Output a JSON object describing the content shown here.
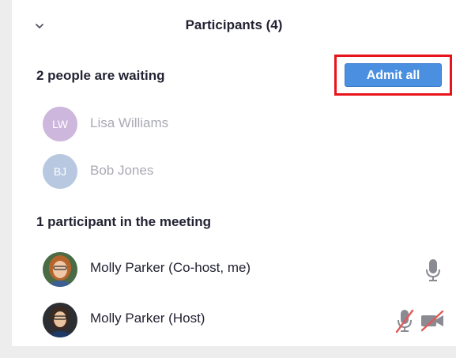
{
  "header": {
    "title": "Participants (4)",
    "collapse_icon": "chevron-down-icon"
  },
  "waiting_room": {
    "heading": "2 people are waiting",
    "admit_all_label": "Admit all",
    "highlight_color": "#e8141b",
    "people": [
      {
        "initials": "LW",
        "name": "Lisa Williams",
        "avatar_color": "#cdb7dc"
      },
      {
        "initials": "BJ",
        "name": "Bob Jones",
        "avatar_color": "#b7c8e0"
      }
    ]
  },
  "meeting": {
    "heading": "1 participant in the meeting",
    "participants": [
      {
        "name": "Molly Parker (Co-host, me)",
        "audio": "unmuted",
        "audio_icon": "microphone-icon"
      },
      {
        "name": "Molly Parker (Host)",
        "audio": "muted",
        "audio_icon": "microphone-muted-icon",
        "video": "off",
        "video_icon": "video-off-icon"
      }
    ]
  },
  "colors": {
    "accent": "#4a8fe0",
    "muted_red": "#e05a5a",
    "icon_gray": "#8a8a93"
  }
}
